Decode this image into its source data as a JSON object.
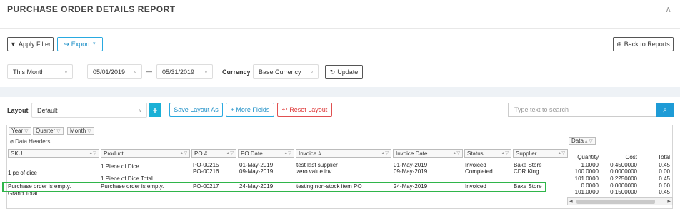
{
  "header": {
    "title": "PURCHASE ORDER DETAILS REPORT",
    "collapse_icon": "chevron-up-icon"
  },
  "toolbar": {
    "apply_filter": "Apply Filter",
    "export": "Export",
    "back": "Back to Reports"
  },
  "filters": {
    "period": "This Month",
    "from_date": "05/01/2019",
    "separator": "—",
    "to_date": "05/31/2019",
    "currency_label": "Currency",
    "currency": "Base Currency",
    "update": "Update"
  },
  "layout_bar": {
    "label": "Layout",
    "layout_value": "Default",
    "add": "+",
    "save_as": "Save Layout As",
    "more_fields": "+ More Fields",
    "reset": "Reset Layout",
    "search_placeholder": "Type text to search"
  },
  "pivot": {
    "filter_chips": [
      "Year",
      "Quarter",
      "Month"
    ],
    "data_headers": "Data Headers",
    "data_chip": "Data",
    "columns": [
      "SKU",
      "Product",
      "PO #",
      "PO Date",
      "Invoice #",
      "Invoice Date",
      "Status",
      "Supplier"
    ],
    "value_headers": [
      "Quantity",
      "Cost",
      "Total"
    ],
    "rows": [
      {
        "sku": "",
        "product": "",
        "po": "PO-00215",
        "po_date": "01-May-2019",
        "invoice": "test last supplier",
        "invoice_date": "01-May-2019",
        "status": "Invoiced",
        "supplier": "Bake Store",
        "qty": "1.0000",
        "cost": "0.4500000",
        "total": "0.45"
      },
      {
        "sku": "",
        "product": "",
        "po": "PO-00216",
        "po_date": "09-May-2019",
        "invoice": "zero value inv",
        "invoice_date": "09-May-2019",
        "status": "Completed",
        "supplier": "CDR King",
        "qty": "100.0000",
        "cost": "0.0000000",
        "total": "0.00"
      },
      {
        "sku": "",
        "product": "",
        "po": "",
        "po_date": "",
        "invoice": "",
        "invoice_date": "",
        "status": "",
        "supplier": "",
        "qty": "101.0000",
        "cost": "0.2250000",
        "total": "0.45"
      },
      {
        "sku": "Purchase order is empty.",
        "product": "Purchase order is empty.",
        "po": "PO-00217",
        "po_date": "24-May-2019",
        "invoice": "testing non-stock item PO",
        "invoice_date": "24-May-2019",
        "status": "Invoiced",
        "supplier": "Bake Store",
        "qty": "0.0000",
        "cost": "0.0000000",
        "total": "0.00"
      },
      {
        "sku": "",
        "product": "",
        "po": "",
        "po_date": "",
        "invoice": "",
        "invoice_date": "",
        "status": "",
        "supplier": "",
        "qty": "101.0000",
        "cost": "0.1500000",
        "total": "0.45"
      }
    ],
    "group_sku": "1 pc of dice",
    "group_product": "1 Piece of Dice",
    "group_total": "1 Piece of Dice Total",
    "grand_total": "Grand Total"
  }
}
